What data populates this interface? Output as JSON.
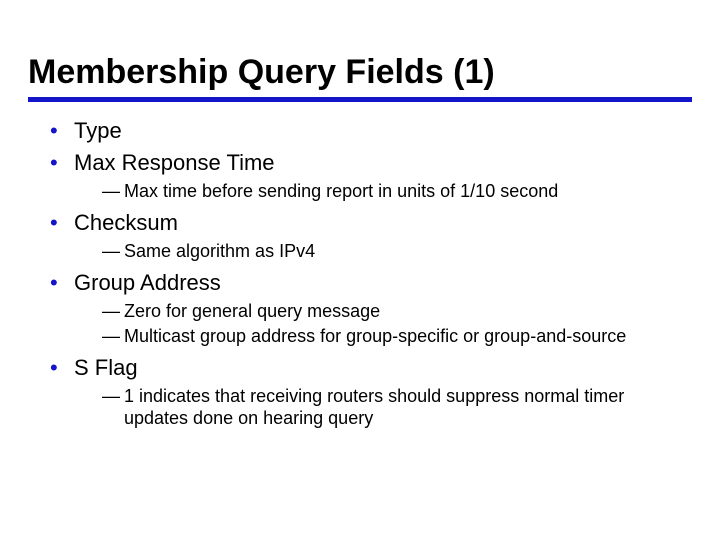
{
  "title": "Membership Query Fields (1)",
  "bullets": [
    {
      "label": "Type",
      "subs": []
    },
    {
      "label": "Max Response Time",
      "subs": [
        "Max time before sending report in units of 1/10 second"
      ]
    },
    {
      "label": "Checksum",
      "subs": [
        "Same algorithm as IPv4"
      ]
    },
    {
      "label": "Group Address",
      "subs": [
        "Zero for general query message",
        "Multicast group address for group-specific or group-and-source"
      ]
    },
    {
      "label": "S Flag",
      "subs": [
        "1 indicates that receiving routers should suppress normal timer updates done on hearing query"
      ]
    }
  ]
}
